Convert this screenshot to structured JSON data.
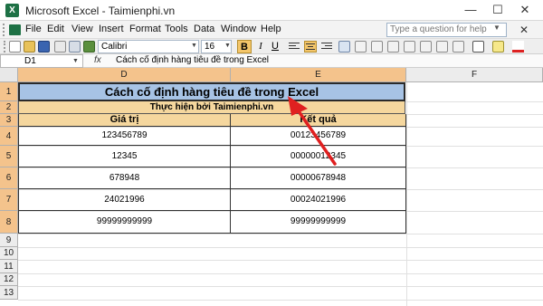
{
  "window": {
    "title": "Microsoft Excel - Taimienphi.vn",
    "app_icon_letter": "X",
    "minimize_glyph": "—",
    "maximize_glyph": "☐",
    "close_glyph": "✕"
  },
  "menu": {
    "items": [
      "File",
      "Edit",
      "View",
      "Insert",
      "Format",
      "Tools",
      "Data",
      "Window",
      "Help"
    ],
    "help_placeholder": "Type a question for help",
    "doc_close_glyph": "✕"
  },
  "toolbar": {
    "font_name": "Calibri",
    "font_size": "16",
    "bold_label": "B",
    "italic_label": "I",
    "underline_label": "U"
  },
  "formula_bar": {
    "name_box": "D1",
    "fx_label": "fx",
    "content": "Cách cố định hàng tiêu đề trong Excel"
  },
  "grid": {
    "columns": [
      "D",
      "E",
      "F"
    ],
    "rows": [
      "1",
      "2",
      "3",
      "4",
      "5",
      "6",
      "7",
      "8",
      "9",
      "10",
      "11",
      "12",
      "13"
    ],
    "title": "Cách cố định hàng tiêu đề trong Excel",
    "subtitle": "Thực hiện bởi Taimienphi.vn",
    "header_d": "Giá trị",
    "header_e": "Kết quả",
    "values": [
      "123456789",
      "12345",
      "678948",
      "24021996",
      "99999999999"
    ],
    "results": [
      "00123456789",
      "00000012345",
      "00000678948",
      "00024021996",
      "99999999999"
    ]
  }
}
